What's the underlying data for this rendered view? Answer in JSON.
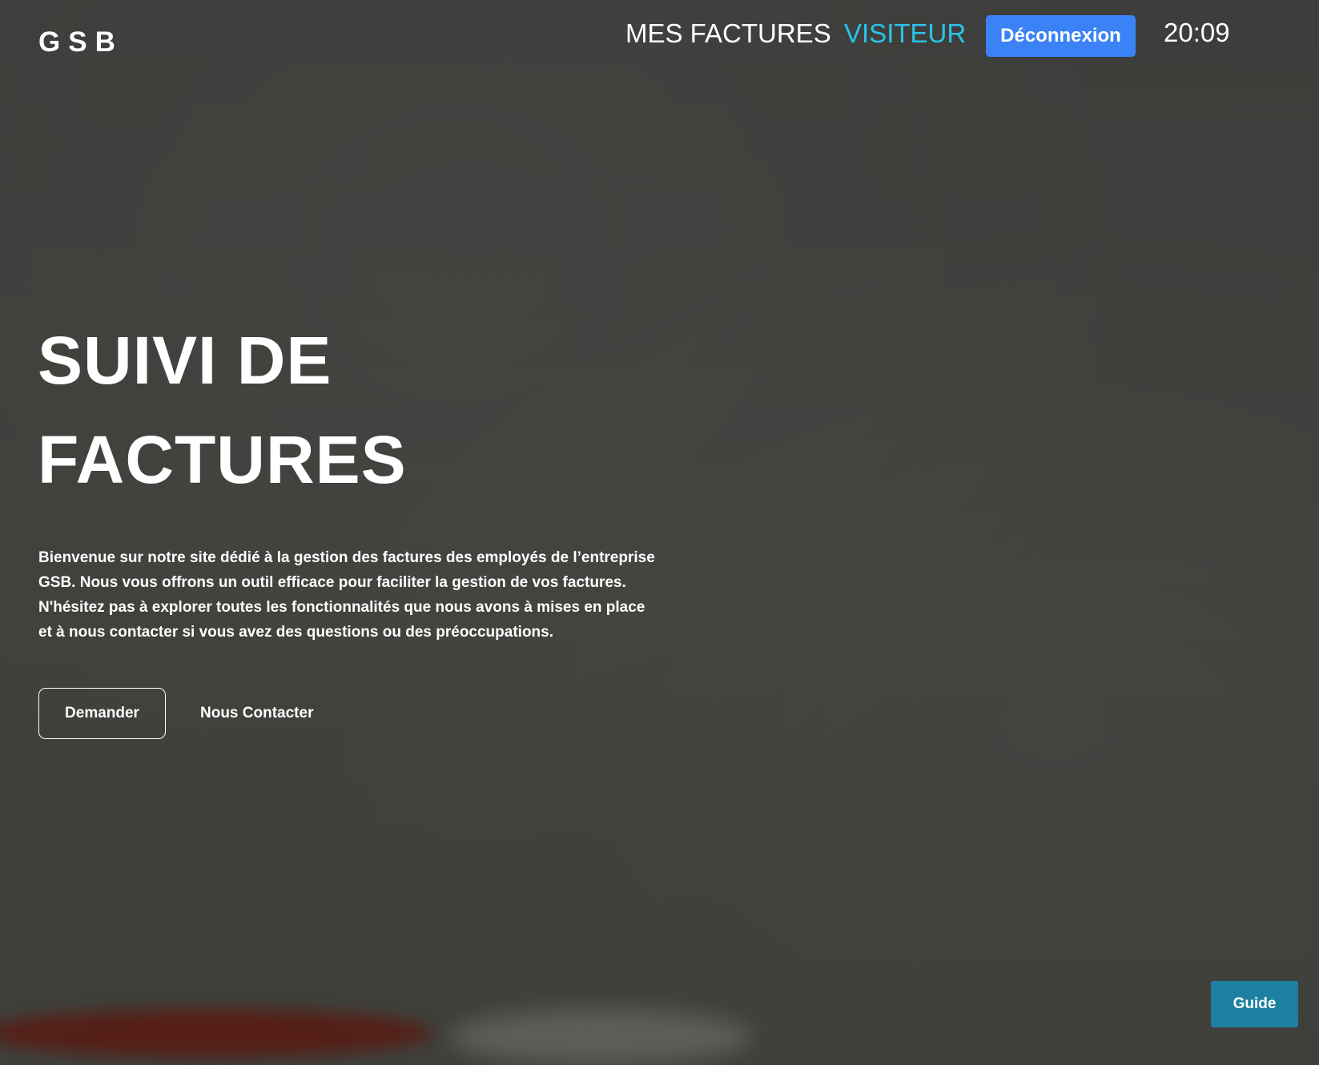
{
  "header": {
    "logo": "GSB",
    "nav": {
      "factures": "MES FACTURES",
      "visiteur": "VISITEUR"
    },
    "logout_label": "Déconnexion",
    "clock": "20:09"
  },
  "hero": {
    "title_line1": "SUIVI DE",
    "title_line2": "FACTURES",
    "intro": "Bienvenue sur notre site dédié à la gestion des factures des employés de l’entreprise GSB. Nous vous offrons un outil efficace pour faciliter la gestion de vos factures. N'hésitez pas à explorer toutes les fonctionnalités que nous avons à mises en place et à nous contacter si vous avez des questions ou des préoccupations.",
    "primary_button": "Demander",
    "secondary_link": "Nous Contacter"
  },
  "guide_button": "Guide",
  "colors": {
    "background": "#3e3f3b",
    "accent_nav": "#2bc3ea",
    "logout_button": "#3b82f6",
    "guide_button": "#1e80a0"
  }
}
